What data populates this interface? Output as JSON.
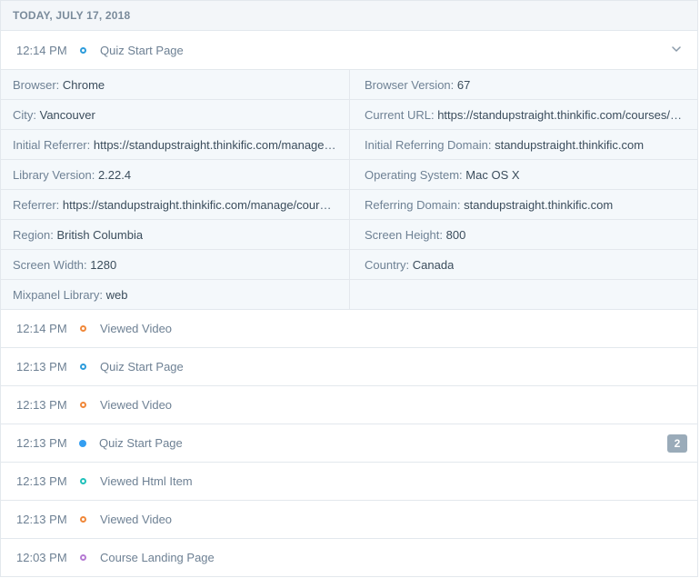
{
  "date_header": "TODAY, JULY 17, 2018",
  "colors": {
    "blue": "#2d9cdb",
    "blue_solid": "#349ef1",
    "orange": "#f0883a",
    "teal": "#21c1bb",
    "purple": "#b57ad3",
    "badge": "#9aabb9"
  },
  "expanded_event": {
    "time": "12:14 PM",
    "name": "Quiz Start Page",
    "dot": "blue",
    "chevron_icon": "chevron-down-icon",
    "properties": [
      [
        {
          "key": "Browser:",
          "value": "Chrome"
        },
        {
          "key": "Browser Version:",
          "value": "67"
        }
      ],
      [
        {
          "key": "City:",
          "value": "Vancouver"
        },
        {
          "key": "Current URL:",
          "value": "https://standupstraight.thinkific.com/courses/take/course-name"
        }
      ],
      [
        {
          "key": "Initial Referrer:",
          "value": "https://standupstraight.thinkific.com/manage/courses"
        },
        {
          "key": "Initial Referring Domain:",
          "value": "standupstraight.thinkific.com"
        }
      ],
      [
        {
          "key": "Library Version:",
          "value": "2.22.4"
        },
        {
          "key": "Operating System:",
          "value": "Mac OS X"
        }
      ],
      [
        {
          "key": "Referrer:",
          "value": "https://standupstraight.thinkific.com/manage/courses"
        },
        {
          "key": "Referring Domain:",
          "value": "standupstraight.thinkific.com"
        }
      ],
      [
        {
          "key": "Region:",
          "value": "British Columbia"
        },
        {
          "key": "Screen Height:",
          "value": "800"
        }
      ],
      [
        {
          "key": "Screen Width:",
          "value": "1280"
        },
        {
          "key": "Country:",
          "value": "Canada"
        }
      ],
      [
        {
          "key": "Mixpanel Library:",
          "value": "web"
        },
        {
          "key": "",
          "value": ""
        }
      ]
    ]
  },
  "events": [
    {
      "time": "12:14 PM",
      "name": "Viewed Video",
      "dot": "orange",
      "badge": ""
    },
    {
      "time": "12:13 PM",
      "name": "Quiz Start Page",
      "dot": "blue",
      "badge": ""
    },
    {
      "time": "12:13 PM",
      "name": "Viewed Video",
      "dot": "orange",
      "badge": ""
    },
    {
      "time": "12:13 PM",
      "name": "Quiz Start Page",
      "dot": "blue_solid",
      "badge": "2"
    },
    {
      "time": "12:13 PM",
      "name": "Viewed Html Item",
      "dot": "teal",
      "badge": ""
    },
    {
      "time": "12:13 PM",
      "name": "Viewed Video",
      "dot": "orange",
      "badge": ""
    },
    {
      "time": "12:03 PM",
      "name": "Course Landing Page",
      "dot": "purple",
      "badge": ""
    }
  ]
}
